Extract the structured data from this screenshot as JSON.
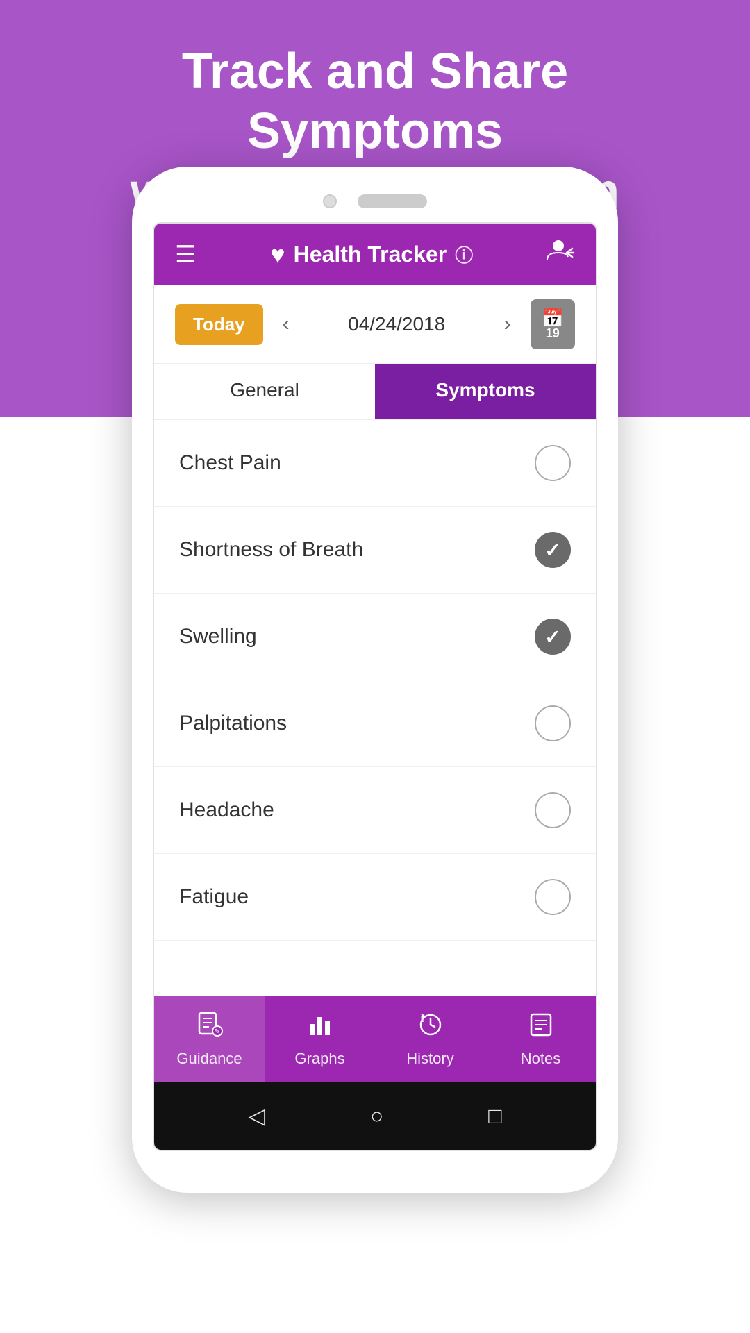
{
  "hero": {
    "text_line1": "Track and Share Symptoms",
    "text_line2": "with Your Care Team"
  },
  "header": {
    "title": "Health Tracker",
    "menu_icon": "☰",
    "heart_icon": "♡",
    "info_icon": "ⓘ",
    "profile_icon": "👤"
  },
  "date_nav": {
    "today_label": "Today",
    "date": "04/24/2018",
    "prev_icon": "‹",
    "next_icon": "›",
    "calendar_day": "19"
  },
  "tabs": [
    {
      "id": "general",
      "label": "General",
      "active": false
    },
    {
      "id": "symptoms",
      "label": "Symptoms",
      "active": true
    }
  ],
  "symptoms": [
    {
      "id": "chest-pain",
      "label": "Chest Pain",
      "checked": false
    },
    {
      "id": "shortness-of-breath",
      "label": "Shortness of Breath",
      "checked": true
    },
    {
      "id": "swelling",
      "label": "Swelling",
      "checked": true
    },
    {
      "id": "palpitations",
      "label": "Palpitations",
      "checked": false
    },
    {
      "id": "headache",
      "label": "Headache",
      "checked": false
    },
    {
      "id": "fatigue",
      "label": "Fatigue",
      "checked": false
    }
  ],
  "bottom_nav": [
    {
      "id": "guidance",
      "icon": "📋",
      "label": "Guidance",
      "active": true
    },
    {
      "id": "graphs",
      "icon": "📊",
      "label": "Graphs",
      "active": false
    },
    {
      "id": "history",
      "icon": "🕐",
      "label": "History",
      "active": false
    },
    {
      "id": "notes",
      "icon": "📝",
      "label": "Notes",
      "active": false
    }
  ],
  "android_nav": {
    "back": "◁",
    "home": "○",
    "recent": "□"
  },
  "colors": {
    "purple": "#9c27b0",
    "orange": "#e8a020",
    "dark_check": "#6a6a6a"
  }
}
